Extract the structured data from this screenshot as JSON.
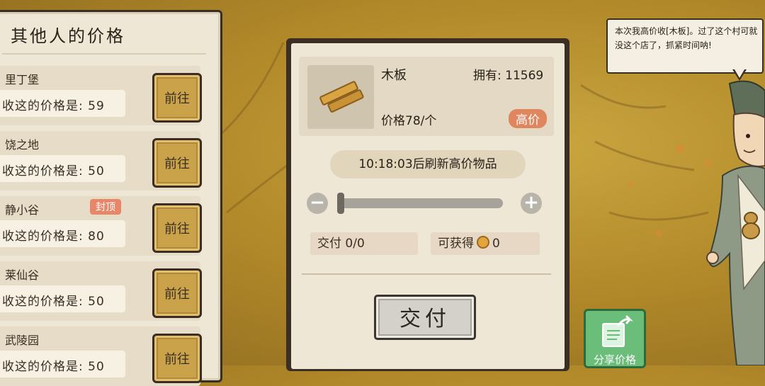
{
  "left_panel": {
    "title": "其他人的价格",
    "items": [
      {
        "name": "里丁堡",
        "price_text": "收这的价格是: 59",
        "button": "前往",
        "badge": ""
      },
      {
        "name": "饶之地",
        "price_text": "收这的价格是: 50",
        "button": "前往",
        "badge": ""
      },
      {
        "name": "静小谷",
        "price_text": "收这的价格是: 80",
        "button": "前往",
        "badge": "封顶"
      },
      {
        "name": "莱仙谷",
        "price_text": "收这的价格是: 50",
        "button": "前往",
        "badge": ""
      },
      {
        "name": "武陵园",
        "price_text": "收这的价格是: 50",
        "button": "前往",
        "badge": ""
      }
    ]
  },
  "trade": {
    "item_name": "木板",
    "owned": "拥有: 11569",
    "price": "价格78/个",
    "high_badge": "高价",
    "refresh_text": "10:18:03后刷新高价物品",
    "slider_value": 0,
    "deliver_info": "交付 0/0",
    "obtain_label": "可获得",
    "obtain_value": "0",
    "deliver_button": "交付",
    "icon": "wood-planks-icon"
  },
  "npc": {
    "speech": "本次我高价收[木板]。过了这个村可就没这个店了，抓紧时间呐!"
  },
  "share": {
    "label": "分享价格"
  },
  "colors": {
    "panel_bg": "#efe7d6",
    "frame": "#3a2e22",
    "high_price": "#e0865e",
    "share_green": "#6bbd7a",
    "goto_gold": "#c9a24a"
  }
}
